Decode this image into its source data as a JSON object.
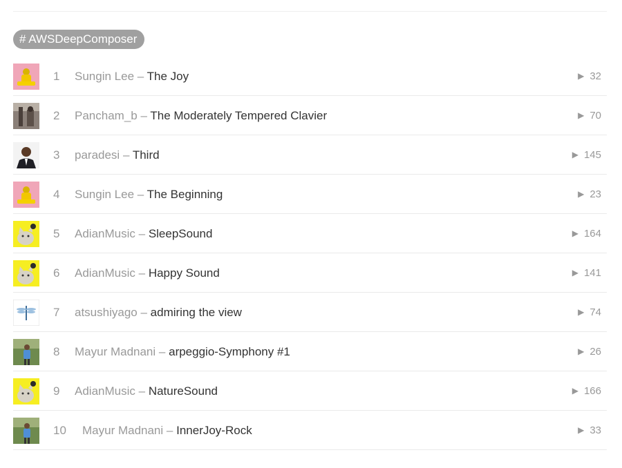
{
  "tag": {
    "label": "# AWSDeepComposer"
  },
  "tracks": [
    {
      "rank": "1",
      "artist": "Sungin Lee",
      "separator": "–",
      "title": "The Joy",
      "plays": "32",
      "art": "yellow-figure-art"
    },
    {
      "rank": "2",
      "artist": "Pancham_b",
      "separator": "–",
      "title": "The Moderately Tempered Clavier",
      "plays": "70",
      "art": "street-photo-art"
    },
    {
      "rank": "3",
      "artist": "paradesi",
      "separator": "–",
      "title": "Third",
      "plays": "145",
      "art": "portrait-photo-art"
    },
    {
      "rank": "4",
      "artist": "Sungin Lee",
      "separator": "–",
      "title": "The Beginning",
      "plays": "23",
      "art": "yellow-figure-art"
    },
    {
      "rank": "5",
      "artist": "AdianMusic",
      "separator": "–",
      "title": "SleepSound",
      "plays": "164",
      "art": "cat-art"
    },
    {
      "rank": "6",
      "artist": "AdianMusic",
      "separator": "–",
      "title": "Happy Sound",
      "plays": "141",
      "art": "cat-art"
    },
    {
      "rank": "7",
      "artist": "atsushiyago",
      "separator": "–",
      "title": "admiring the view",
      "plays": "74",
      "art": "dragonfly-art"
    },
    {
      "rank": "8",
      "artist": "Mayur Madnani",
      "separator": "–",
      "title": "arpeggio-Symphony #1",
      "plays": "26",
      "art": "outdoor-person-art"
    },
    {
      "rank": "9",
      "artist": "AdianMusic",
      "separator": "–",
      "title": "NatureSound",
      "plays": "166",
      "art": "cat-art"
    },
    {
      "rank": "10",
      "artist": "Mayur Madnani",
      "separator": "–",
      "title": "InnerJoy-Rock",
      "plays": "33",
      "art": "outdoor-person-art"
    }
  ],
  "icons": {
    "play": "play-icon"
  },
  "colors": {
    "tag_bg": "#a0a0a0",
    "muted_text": "#999999",
    "title_text": "#333333"
  }
}
